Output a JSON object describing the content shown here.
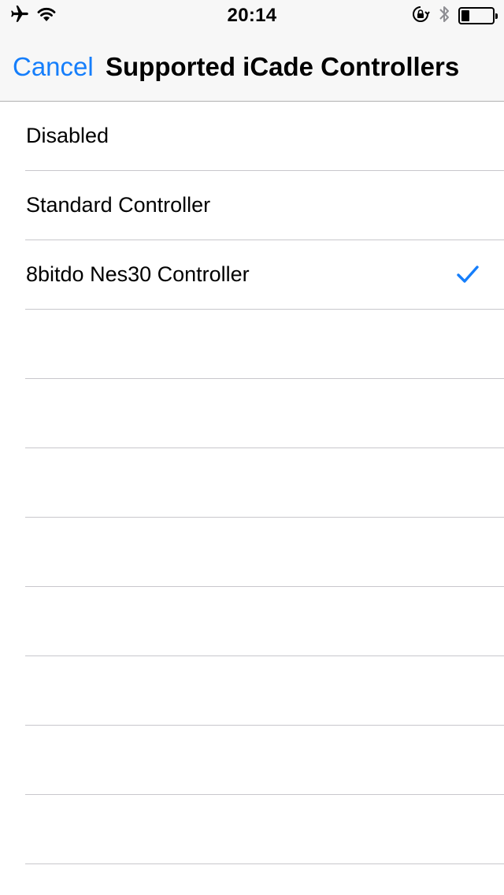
{
  "status_bar": {
    "time": "20:14",
    "left_icons": [
      "airplane-icon",
      "wifi-icon"
    ],
    "right_icons": [
      "orientation-lock-icon",
      "bluetooth-icon",
      "battery-icon"
    ],
    "battery_level": 0.25
  },
  "nav": {
    "cancel_label": "Cancel",
    "title": "Supported iCade Controllers"
  },
  "list": {
    "items": [
      {
        "label": "Disabled",
        "selected": false
      },
      {
        "label": "Standard Controller",
        "selected": false
      },
      {
        "label": "8bitdo Nes30 Controller",
        "selected": true
      }
    ],
    "empty_rows": 8,
    "checkmark_icon": "checkmark-icon"
  },
  "colors": {
    "accent": "#157efb",
    "nav_background": "#f7f7f7",
    "separator": "#c8c7cc"
  }
}
